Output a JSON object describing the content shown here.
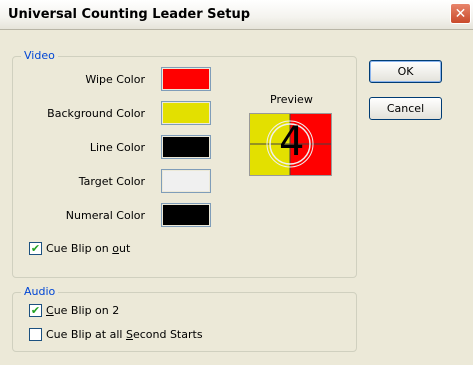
{
  "window": {
    "title": "Universal Counting Leader Setup",
    "close_glyph": "✕"
  },
  "video_group": {
    "label": "Video",
    "rows": [
      {
        "label": "Wipe Color",
        "color": "#ff0000"
      },
      {
        "label": "Background Color",
        "color": "#e3e000"
      },
      {
        "label": "Line Color",
        "color": "#000000"
      },
      {
        "label": "Target Color",
        "color": "#f0f0f0"
      },
      {
        "label": "Numeral Color",
        "color": "#000000"
      }
    ],
    "preview_label": "Preview",
    "preview_numeral": "4",
    "cue_blip_out": {
      "label_pre": "Cue Blip on ",
      "label_u": "o",
      "label_post": "ut",
      "checked": true
    }
  },
  "audio_group": {
    "label": "Audio",
    "cue_blip_2": {
      "label_pre": "",
      "label_u": "C",
      "label_post": "ue Blip on 2",
      "checked": true
    },
    "cue_blip_second": {
      "label_pre": "Cue Blip at all ",
      "label_u": "S",
      "label_post": "econd Starts",
      "checked": false
    }
  },
  "buttons": {
    "ok": "OK",
    "cancel": "Cancel"
  }
}
